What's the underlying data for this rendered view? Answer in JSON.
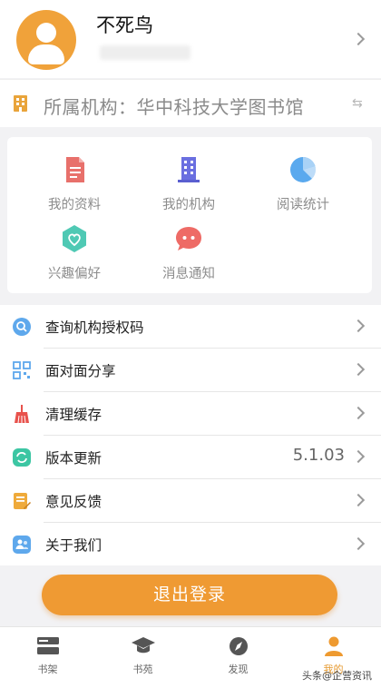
{
  "profile": {
    "name": "不死鸟"
  },
  "institution": {
    "text": "所属机构：华中科技大学图书馆"
  },
  "grid": [
    {
      "label": "我的资料",
      "icon": "document-icon"
    },
    {
      "label": "我的机构",
      "icon": "building-icon"
    },
    {
      "label": "阅读统计",
      "icon": "pie-chart-icon"
    },
    {
      "label": "兴趣偏好",
      "icon": "heart-hexagon-icon"
    },
    {
      "label": "消息通知",
      "icon": "message-icon"
    }
  ],
  "list": [
    {
      "label": "查询机构授权码",
      "icon": "search-icon"
    },
    {
      "label": "面对面分享",
      "icon": "qr-code-icon"
    },
    {
      "label": "清理缓存",
      "icon": "broom-icon"
    },
    {
      "label": "版本更新",
      "icon": "refresh-icon",
      "value": "5.1.03"
    },
    {
      "label": "意见反馈",
      "icon": "feedback-icon"
    },
    {
      "label": "关于我们",
      "icon": "about-icon"
    }
  ],
  "logout_label": "退出登录",
  "tabs": [
    {
      "label": "书架",
      "icon": "bookshelf-icon"
    },
    {
      "label": "书苑",
      "icon": "graduation-cap-icon"
    },
    {
      "label": "发现",
      "icon": "compass-icon"
    },
    {
      "label": "我的",
      "icon": "user-icon",
      "active": true
    }
  ],
  "watermark": "头条@企营资讯",
  "colors": {
    "accent": "#ef9a33",
    "background": "#f2f2f4"
  }
}
